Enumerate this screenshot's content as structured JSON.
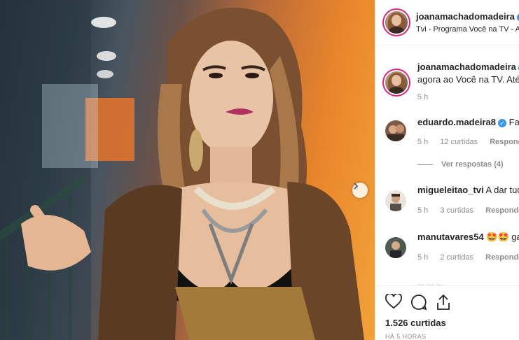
{
  "post": {
    "author": "joanamachadomadeira",
    "location": "Tvi - Programa Você na TV - Ac",
    "caption_author": "joanamachadomadeira",
    "caption_text": "agora ao Você na TV. Até",
    "caption_time": "5 h"
  },
  "comments": [
    {
      "user": "eduardo.madeira8",
      "verified": true,
      "text": "Fazi",
      "time": "5 h",
      "likes": "12 curtidas",
      "reply": "Respond"
    },
    {
      "user": "migueleitao_tvi",
      "verified": false,
      "text": "A dar tud",
      "time": "5 h",
      "likes": "3 curtidas",
      "reply": "Responde"
    },
    {
      "user": "manutavares54",
      "verified": false,
      "text": "🤩🤩 ga",
      "time": "5 h",
      "likes": "2 curtidas",
      "reply": "Responde"
    }
  ],
  "view_replies": "Ver respostas (4)",
  "faded_text": "... ... ...",
  "likes_count": "1.526 curtidas",
  "time_ago": "HÁ 5 HORAS",
  "icons": {
    "like": "heart-icon",
    "comment": "comment-icon",
    "share": "share-icon",
    "next": "chevron-right-icon",
    "verified": "verified-icon"
  },
  "colors": {
    "accent": "#3897f0",
    "story_ring": "#d6297c"
  }
}
